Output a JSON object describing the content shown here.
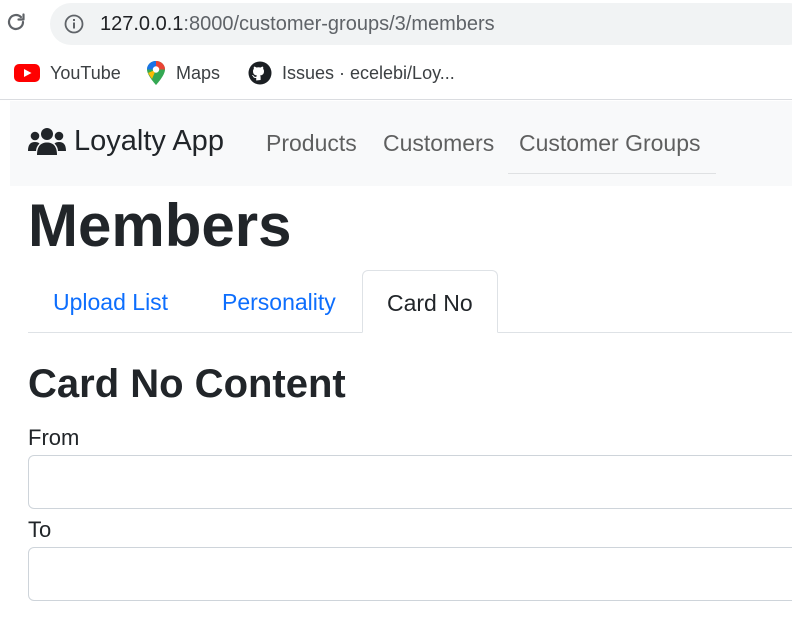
{
  "browser": {
    "url_host": "127.0.0.1",
    "url_rest": ":8000/customer-groups/3/members",
    "bookmarks": [
      {
        "label": "YouTube",
        "icon": "youtube-icon"
      },
      {
        "label": "Maps",
        "icon": "maps-icon"
      },
      {
        "label": "Issues · ecelebi/Loy...",
        "icon": "github-icon"
      }
    ]
  },
  "navbar": {
    "brand": "Loyalty App",
    "brand_icon": "users-icon",
    "links": [
      "Products",
      "Customers",
      "Customer Groups"
    ],
    "active_link": "Customer Groups"
  },
  "page": {
    "title": "Members",
    "tabs": [
      "Upload List",
      "Personality",
      "Card No"
    ],
    "active_tab": "Card No",
    "section_title": "Card No Content",
    "fields": [
      {
        "label": "From",
        "value": ""
      },
      {
        "label": "To",
        "value": ""
      }
    ]
  },
  "colors": {
    "link": "#0d6efd",
    "navbar_bg": "#f8f9fa",
    "text": "#212529"
  }
}
